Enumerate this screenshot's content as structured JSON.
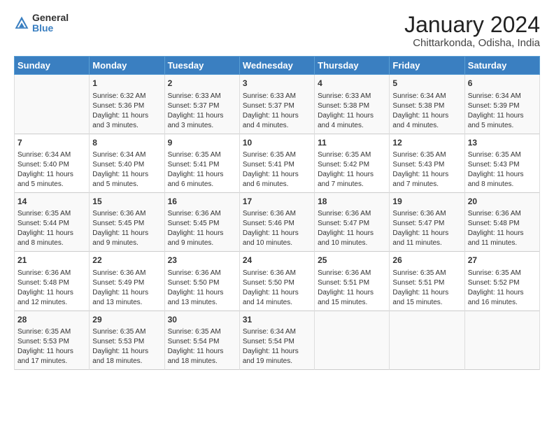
{
  "logo": {
    "general": "General",
    "blue": "Blue"
  },
  "header": {
    "month": "January 2024",
    "location": "Chittarkonda, Odisha, India"
  },
  "columns": [
    "Sunday",
    "Monday",
    "Tuesday",
    "Wednesday",
    "Thursday",
    "Friday",
    "Saturday"
  ],
  "weeks": [
    [
      {
        "day": "",
        "content": ""
      },
      {
        "day": "1",
        "content": "Sunrise: 6:32 AM\nSunset: 5:36 PM\nDaylight: 11 hours\nand 3 minutes."
      },
      {
        "day": "2",
        "content": "Sunrise: 6:33 AM\nSunset: 5:37 PM\nDaylight: 11 hours\nand 3 minutes."
      },
      {
        "day": "3",
        "content": "Sunrise: 6:33 AM\nSunset: 5:37 PM\nDaylight: 11 hours\nand 4 minutes."
      },
      {
        "day": "4",
        "content": "Sunrise: 6:33 AM\nSunset: 5:38 PM\nDaylight: 11 hours\nand 4 minutes."
      },
      {
        "day": "5",
        "content": "Sunrise: 6:34 AM\nSunset: 5:38 PM\nDaylight: 11 hours\nand 4 minutes."
      },
      {
        "day": "6",
        "content": "Sunrise: 6:34 AM\nSunset: 5:39 PM\nDaylight: 11 hours\nand 5 minutes."
      }
    ],
    [
      {
        "day": "7",
        "content": "Sunrise: 6:34 AM\nSunset: 5:40 PM\nDaylight: 11 hours\nand 5 minutes."
      },
      {
        "day": "8",
        "content": "Sunrise: 6:34 AM\nSunset: 5:40 PM\nDaylight: 11 hours\nand 5 minutes."
      },
      {
        "day": "9",
        "content": "Sunrise: 6:35 AM\nSunset: 5:41 PM\nDaylight: 11 hours\nand 6 minutes."
      },
      {
        "day": "10",
        "content": "Sunrise: 6:35 AM\nSunset: 5:41 PM\nDaylight: 11 hours\nand 6 minutes."
      },
      {
        "day": "11",
        "content": "Sunrise: 6:35 AM\nSunset: 5:42 PM\nDaylight: 11 hours\nand 7 minutes."
      },
      {
        "day": "12",
        "content": "Sunrise: 6:35 AM\nSunset: 5:43 PM\nDaylight: 11 hours\nand 7 minutes."
      },
      {
        "day": "13",
        "content": "Sunrise: 6:35 AM\nSunset: 5:43 PM\nDaylight: 11 hours\nand 8 minutes."
      }
    ],
    [
      {
        "day": "14",
        "content": "Sunrise: 6:35 AM\nSunset: 5:44 PM\nDaylight: 11 hours\nand 8 minutes."
      },
      {
        "day": "15",
        "content": "Sunrise: 6:36 AM\nSunset: 5:45 PM\nDaylight: 11 hours\nand 9 minutes."
      },
      {
        "day": "16",
        "content": "Sunrise: 6:36 AM\nSunset: 5:45 PM\nDaylight: 11 hours\nand 9 minutes."
      },
      {
        "day": "17",
        "content": "Sunrise: 6:36 AM\nSunset: 5:46 PM\nDaylight: 11 hours\nand 10 minutes."
      },
      {
        "day": "18",
        "content": "Sunrise: 6:36 AM\nSunset: 5:47 PM\nDaylight: 11 hours\nand 10 minutes."
      },
      {
        "day": "19",
        "content": "Sunrise: 6:36 AM\nSunset: 5:47 PM\nDaylight: 11 hours\nand 11 minutes."
      },
      {
        "day": "20",
        "content": "Sunrise: 6:36 AM\nSunset: 5:48 PM\nDaylight: 11 hours\nand 11 minutes."
      }
    ],
    [
      {
        "day": "21",
        "content": "Sunrise: 6:36 AM\nSunset: 5:48 PM\nDaylight: 11 hours\nand 12 minutes."
      },
      {
        "day": "22",
        "content": "Sunrise: 6:36 AM\nSunset: 5:49 PM\nDaylight: 11 hours\nand 13 minutes."
      },
      {
        "day": "23",
        "content": "Sunrise: 6:36 AM\nSunset: 5:50 PM\nDaylight: 11 hours\nand 13 minutes."
      },
      {
        "day": "24",
        "content": "Sunrise: 6:36 AM\nSunset: 5:50 PM\nDaylight: 11 hours\nand 14 minutes."
      },
      {
        "day": "25",
        "content": "Sunrise: 6:36 AM\nSunset: 5:51 PM\nDaylight: 11 hours\nand 15 minutes."
      },
      {
        "day": "26",
        "content": "Sunrise: 6:35 AM\nSunset: 5:51 PM\nDaylight: 11 hours\nand 15 minutes."
      },
      {
        "day": "27",
        "content": "Sunrise: 6:35 AM\nSunset: 5:52 PM\nDaylight: 11 hours\nand 16 minutes."
      }
    ],
    [
      {
        "day": "28",
        "content": "Sunrise: 6:35 AM\nSunset: 5:53 PM\nDaylight: 11 hours\nand 17 minutes."
      },
      {
        "day": "29",
        "content": "Sunrise: 6:35 AM\nSunset: 5:53 PM\nDaylight: 11 hours\nand 18 minutes."
      },
      {
        "day": "30",
        "content": "Sunrise: 6:35 AM\nSunset: 5:54 PM\nDaylight: 11 hours\nand 18 minutes."
      },
      {
        "day": "31",
        "content": "Sunrise: 6:34 AM\nSunset: 5:54 PM\nDaylight: 11 hours\nand 19 minutes."
      },
      {
        "day": "",
        "content": ""
      },
      {
        "day": "",
        "content": ""
      },
      {
        "day": "",
        "content": ""
      }
    ]
  ]
}
